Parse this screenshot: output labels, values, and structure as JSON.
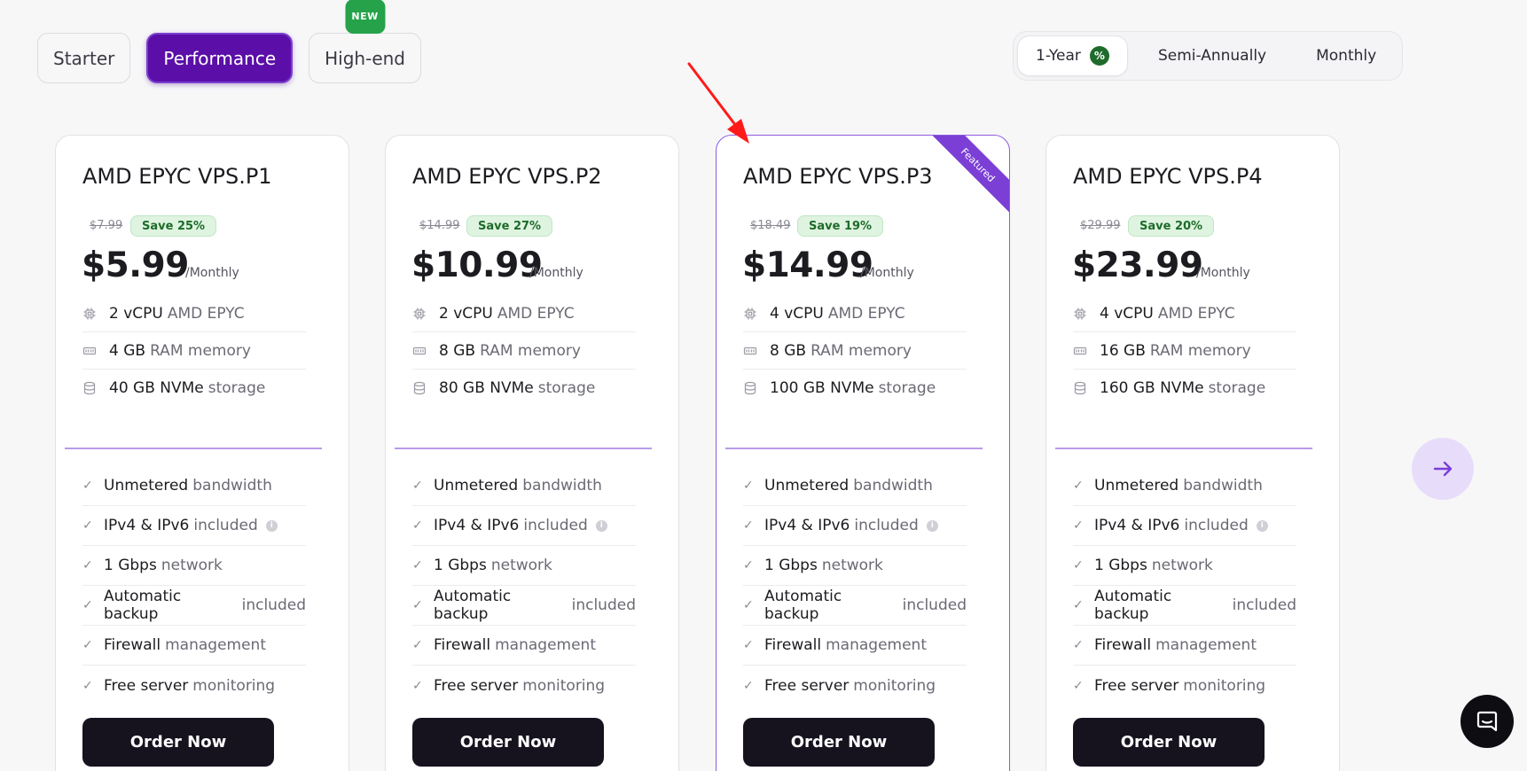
{
  "tiers": {
    "tabs": [
      {
        "label": "Starter"
      },
      {
        "label": "Performance"
      },
      {
        "label": "High-end"
      }
    ],
    "new_badge": "NEW"
  },
  "billing": {
    "options": [
      "1-Year",
      "Semi-Annually",
      "Monthly"
    ],
    "discount_symbol": "%"
  },
  "featured_label": "Featured",
  "plans": [
    {
      "name": "AMD EPYC VPS.P1",
      "old_price": "$7.99",
      "save": "Save 25%",
      "price": "$5.99",
      "per": "/Monthly",
      "cpu_value": "2 vCPU",
      "cpu_label": "AMD EPYC",
      "ram_value": "4 GB",
      "ram_label": "RAM memory",
      "storage_value": "40 GB NVMe",
      "storage_label": "storage"
    },
    {
      "name": "AMD EPYC VPS.P2",
      "old_price": "$14.99",
      "save": "Save 27%",
      "price": "$10.99",
      "per": "/Monthly",
      "cpu_value": "2 vCPU",
      "cpu_label": "AMD EPYC",
      "ram_value": "8 GB",
      "ram_label": "RAM memory",
      "storage_value": "80 GB NVMe",
      "storage_label": "storage"
    },
    {
      "name": "AMD EPYC VPS.P3",
      "old_price": "$18.49",
      "save": "Save 19%",
      "price": "$14.99",
      "per": "/Monthly",
      "cpu_value": "4 vCPU",
      "cpu_label": "AMD EPYC",
      "ram_value": "8 GB",
      "ram_label": "RAM memory",
      "storage_value": "100 GB NVMe",
      "storage_label": "storage"
    },
    {
      "name": "AMD EPYC VPS.P4",
      "old_price": "$29.99",
      "save": "Save 20%",
      "price": "$23.99",
      "per": "/Monthly",
      "cpu_value": "4 vCPU",
      "cpu_label": "AMD EPYC",
      "ram_value": "16 GB",
      "ram_label": "RAM memory",
      "storage_value": "160 GB NVMe",
      "storage_label": "storage"
    }
  ],
  "features": [
    {
      "strong": "Unmetered",
      "muted": "bandwidth"
    },
    {
      "strong": "IPv4 & IPv6",
      "muted": "included"
    },
    {
      "strong": "1 Gbps",
      "muted": "network"
    },
    {
      "strong": "Automatic backup",
      "muted": "included"
    },
    {
      "strong": "Firewall",
      "muted": "management"
    },
    {
      "strong": "Free server",
      "muted": "monitoring"
    }
  ],
  "order_label": "Order Now",
  "icons": {
    "next": "arrow-right-icon",
    "chat": "chat-bubble-icon",
    "check": "check-icon",
    "info": "info-icon",
    "cpu": "cpu-chip-icon",
    "ram": "memory-icon",
    "storage": "database-icon"
  },
  "colors": {
    "accent": "#5b0fa8",
    "ribbon": "#7b3fd6",
    "save_bg": "#dff4e0",
    "button": "#16131f",
    "annotation_arrow": "#ff1a1a"
  }
}
